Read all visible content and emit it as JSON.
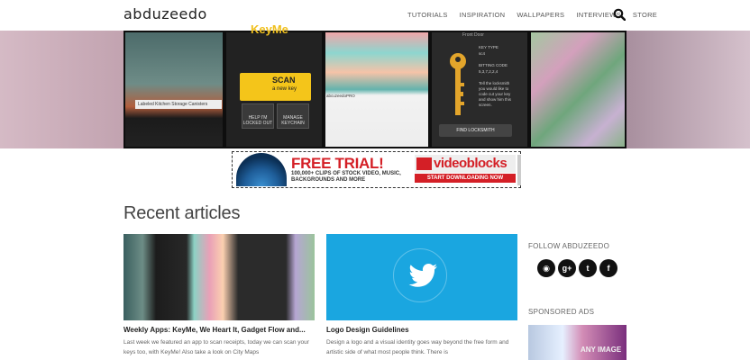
{
  "site": {
    "logo": "abduzeedo",
    "nav": [
      "TUTORIALS",
      "INSPIRATION",
      "WALLPAPERS",
      "INTERVIEWS",
      "STORE"
    ]
  },
  "hero": {
    "keyme_logo": "KeyMe",
    "scan_title": "SCAN",
    "scan_sub": "a new key",
    "tiles": [
      "HELP I'M LOCKED OUT",
      "MANAGE KEYCHAIN"
    ],
    "front_door": "Front Door",
    "key_info": [
      "KEY TYPE",
      "sc4",
      "BITTING CODE",
      "5,3,7,2,2,4",
      "Tell the locksmith",
      "you would like to",
      "code cut your key",
      "and show him this",
      "screen."
    ],
    "find_locksmith": "FIND LOCKSMITH",
    "kitchen_label": "Labeled Kitchen Storage Canisters",
    "insta_head": "abcuzeedoPRO"
  },
  "ad": {
    "headline": "FREE TRIAL!",
    "sub": "100,000+ CLIPS OF STOCK VIDEO, MUSIC, BACKGROUNDS AND MORE",
    "brand": "videoblocks",
    "cta": "START DOWNLOADING NOW"
  },
  "recent": {
    "title": "Recent articles",
    "articles": [
      {
        "title": "Weekly Apps: KeyMe, We Heart It, Gadget Flow and...",
        "excerpt": "Last week we featured an app to scan receipts, today we can scan your keys too, with KeyMe! Also take a look on City Maps"
      },
      {
        "title": "Logo Design Guidelines",
        "excerpt": "Design a logo and a visual identity goes way beyond the free form and artistic side of what most people think. There is"
      }
    ]
  },
  "sidebar": {
    "follow_title": "FOLLOW ABDUZEEDO",
    "socials": [
      {
        "icon": "rss-icon",
        "glyph": "◉"
      },
      {
        "icon": "google-plus-icon",
        "glyph": "g+"
      },
      {
        "icon": "twitter-icon",
        "glyph": "t"
      },
      {
        "icon": "facebook-icon",
        "glyph": "f"
      }
    ],
    "sponsored_title": "SPONSORED ADS",
    "sponsored_text": "ANY IMAGE"
  },
  "colors": {
    "accent_red": "#d41f26",
    "twitter_blue": "#1aa6e0",
    "keyme_yellow": "#f4c51a"
  }
}
